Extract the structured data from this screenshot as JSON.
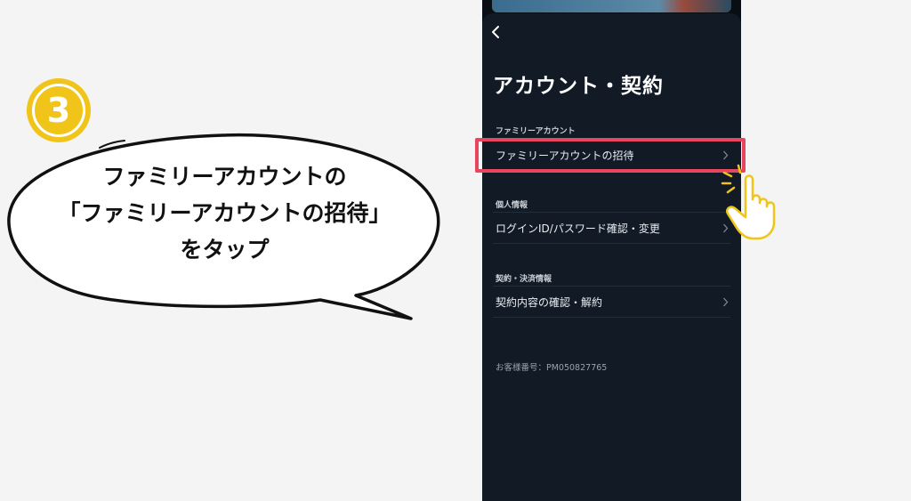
{
  "step": {
    "number": "3",
    "color": "#f0c419"
  },
  "callout": {
    "lines": [
      "ファミリーアカウントの",
      "「ファミリーアカウントの招待」",
      "をタップ"
    ]
  },
  "screen": {
    "title": "アカウント・契約",
    "sections": [
      {
        "label": "ファミリーアカウント",
        "items": [
          {
            "label": "ファミリーアカウントの招待",
            "highlighted": true
          }
        ]
      },
      {
        "label": "個人情報",
        "items": [
          {
            "label": "ログインID/パスワード確認・変更"
          }
        ]
      },
      {
        "label": "契約・決済情報",
        "items": [
          {
            "label": "契約内容の確認・解約"
          }
        ]
      }
    ],
    "customer_number": "お客様番号：PM050827765"
  },
  "icons": {
    "back": "chevron-left-icon",
    "row": "chevron-right-icon",
    "pointer": "pointing-hand-icon"
  },
  "colors": {
    "highlight": "#e8455e",
    "sheet_background": "#111a25",
    "hand": "#f0c419"
  }
}
